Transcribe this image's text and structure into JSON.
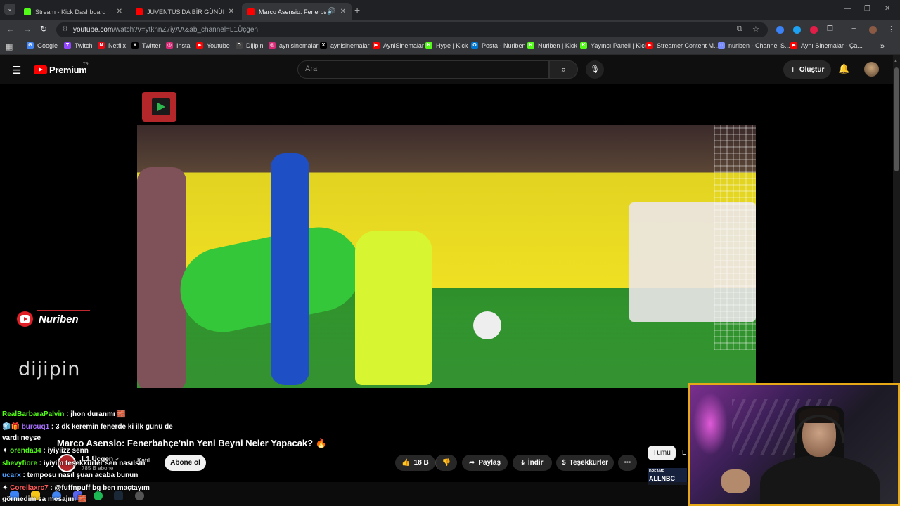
{
  "browser": {
    "tabs": [
      {
        "title": "Stream - Kick Dashboard",
        "icon": "kick-icon",
        "color": "#53fc18",
        "active": false
      },
      {
        "title": "JUVENTUS'DA BİR GÜNÜM! - Y",
        "icon": "youtube-icon",
        "color": "#ff0000",
        "active": false
      },
      {
        "title": "Marco Asensio: Fenerbahçe",
        "icon": "youtube-icon",
        "color": "#ff0000",
        "active": true
      }
    ],
    "new_tab": "+",
    "url_host": "youtube.com",
    "url_path": "/watch?v=ytknnZ7iyAA&ab_channel=L1Üçgen",
    "bookmarks": [
      {
        "label": "Google",
        "color": "#4285f4",
        "glyph": "G"
      },
      {
        "label": "Twitch",
        "color": "#9146ff",
        "glyph": "T"
      },
      {
        "label": "Netflix",
        "color": "#e50914",
        "glyph": "N"
      },
      {
        "label": "Twitter",
        "color": "#000000",
        "glyph": "X"
      },
      {
        "label": "Insta",
        "color": "#d62976",
        "glyph": "◎"
      },
      {
        "label": "Youtube",
        "color": "#ff0000",
        "glyph": "▶"
      },
      {
        "label": "Dijipin",
        "color": "#444444",
        "glyph": "D"
      },
      {
        "label": "aynisinemalar",
        "color": "#d62976",
        "glyph": "◎"
      },
      {
        "label": "aynisinemalar",
        "color": "#000000",
        "glyph": "X"
      },
      {
        "label": "AyniSinemalar",
        "color": "#ff0000",
        "glyph": "▶"
      },
      {
        "label": "Hype | Kick",
        "color": "#53fc18",
        "glyph": "K"
      },
      {
        "label": "Posta - Nuriben",
        "color": "#0078d4",
        "glyph": "O"
      },
      {
        "label": "Nuriben | Kick",
        "color": "#53fc18",
        "glyph": "K"
      },
      {
        "label": "Yayıncı Paneli | Kick",
        "color": "#53fc18",
        "glyph": "K"
      },
      {
        "label": "Streamer Content M...",
        "color": "#ff0000",
        "glyph": "▶"
      },
      {
        "label": "nuriben - Channel S...",
        "color": "#7b8cff",
        "glyph": "◌"
      },
      {
        "label": "Aynı Sinemalar - Ça...",
        "color": "#ff0000",
        "glyph": "▶"
      }
    ],
    "more_bookmarks": "»"
  },
  "youtube": {
    "brand": "Premium",
    "region": "TR",
    "search_placeholder": "Ara",
    "create_label": "Oluştur"
  },
  "overlay": {
    "streamer_name": "Nuriben",
    "sponsor": "dijipin",
    "chat": [
      {
        "user": "RealBarbaraPalvin",
        "color": "#53fc18",
        "badge": "",
        "text": " : jhon duranmı 🧱"
      },
      {
        "user": "burcuq1",
        "color": "#a970ff",
        "badge": "🧊🎁 ",
        "text": " : 3 dk keremin fenerde ki ilk günü de"
      },
      {
        "user": "",
        "color": "#ffffff",
        "badge": "",
        "text": "vardı neyse"
      },
      {
        "user": "orenda34",
        "color": "#53fc18",
        "badge": "✦ ",
        "text": " : iyiyiizz senn"
      },
      {
        "user": "shevyfiore",
        "color": "#53fc18",
        "badge": "",
        "text": " : iyiyim teşekkürler sen nasılsın"
      },
      {
        "user": "ucarx",
        "color": "#4ea1ff",
        "badge": "",
        "text": " : temposu nasıl şuan acaba bunun"
      },
      {
        "user": "Corellaxrc7",
        "color": "#ff5a5a",
        "badge": "✦ ",
        "text": " : @fuffnpuff bg ben maçtayım"
      },
      {
        "user": "",
        "color": "#ffffff",
        "badge": "",
        "text": "görmedim sa mesajını 🧱"
      }
    ]
  },
  "video": {
    "title": "Marco Asensio: Fenerbahçe'nin Yeni Beyni Neler Yapacak? 🔥",
    "channel": "L1 Üçgen",
    "verified": "✔",
    "subscribers": "785 B abone",
    "join_label": "Katıl",
    "subscribe_label": "Abone ol",
    "likes": "18 B",
    "share_label": "Paylaş",
    "download_label": "İndir",
    "thanks_label": "Teşekkürler",
    "more_label": "⋯"
  },
  "recommendations": {
    "filter_all": "Tümü",
    "filter_next": "L",
    "thumb_top": "DREAME",
    "thumb_main": "ALLNBC"
  }
}
